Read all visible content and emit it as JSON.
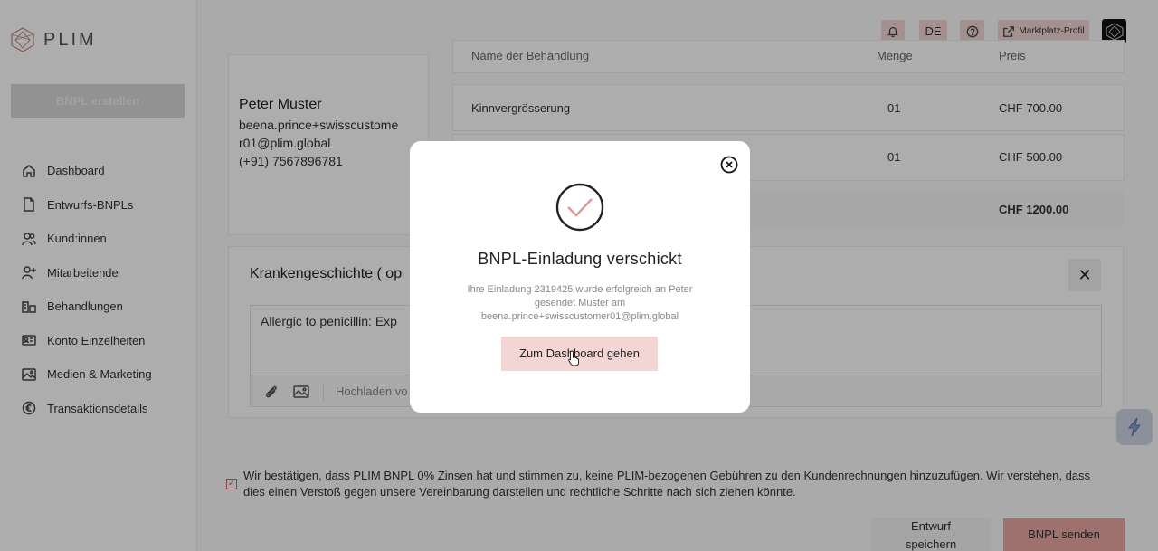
{
  "app": {
    "logo_text": "PLIM"
  },
  "sidebar": {
    "create_button": "BNPL erstellen",
    "items": [
      {
        "label": "Dashboard",
        "icon": "home-icon"
      },
      {
        "label": "Entwurfs-BNPLs",
        "icon": "document-icon"
      },
      {
        "label": "Kund:innen",
        "icon": "users-icon"
      },
      {
        "label": "Mitarbeitende",
        "icon": "user-add-icon"
      },
      {
        "label": "Behandlungen",
        "icon": "treatment-icon"
      },
      {
        "label": "Konto Einzelheiten",
        "icon": "id-card-icon"
      },
      {
        "label": "Medien & Marketing",
        "icon": "image-icon"
      },
      {
        "label": "Transaktionsdetails",
        "icon": "euro-icon"
      }
    ]
  },
  "header": {
    "language": "DE",
    "marketplace_label": "Marktplatz-Profil"
  },
  "customer": {
    "name": "Peter Muster",
    "email_line1": "beena.prince+swisscustome",
    "email_line2": "r01@plim.global",
    "phone": "(+91) 7567896781"
  },
  "treatments": {
    "headers": {
      "name": "Name der Behandlung",
      "quantity": "Menge",
      "price": "Preis"
    },
    "rows": [
      {
        "name": "Kinnvergrösserung",
        "quantity": "01",
        "price": "CHF 700.00"
      },
      {
        "name": "",
        "quantity": "01",
        "price": "CHF 500.00"
      }
    ],
    "total": "CHF 1200.00"
  },
  "history": {
    "title": "Krankengeschichte ( op",
    "text": "Allergic to penicillin: Exp",
    "upload_placeholder": "Hochladen vo"
  },
  "consent": {
    "text": "Wir bestätigen, dass PLIM BNPL 0% Zinsen hat und stimmen zu, keine PLIM-bezogenen Gebühren zu den Kundenrechnungen hinzuzufügen. Wir verstehen, dass dies einen Verstoß gegen unsere Vereinbarung darstellen und rechtliche Schritte nach sich ziehen könnte."
  },
  "actions": {
    "draft_line1": "Entwurf",
    "draft_line2": "speichern",
    "send": "BNPL senden"
  },
  "modal": {
    "title": "BNPL-Einladung verschickt",
    "desc_line1": "Ihre Einladung 2319425 wurde erfolgreich an Peter",
    "desc_line2": "gesendet Muster am",
    "desc_line3": "beena.prince+swisscustomer01@plim.global",
    "button": "Zum Dashboard gehen"
  },
  "colors": {
    "accent": "#e9a6a2",
    "accent_light": "#f3d6d4",
    "check_stroke": "#d99a98"
  }
}
